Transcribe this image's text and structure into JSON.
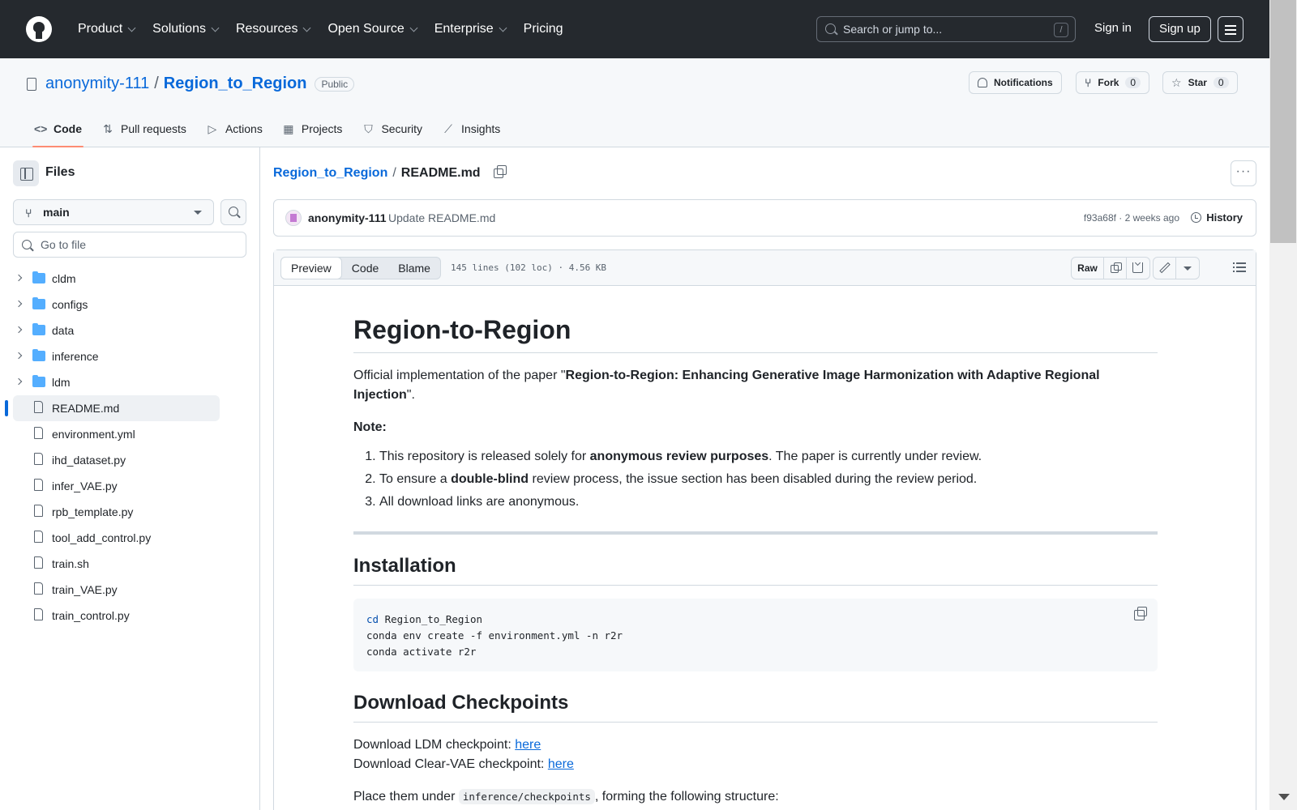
{
  "header": {
    "nav": [
      "Product",
      "Solutions",
      "Resources",
      "Open Source",
      "Enterprise",
      "Pricing"
    ],
    "search_placeholder": "Search or jump to...",
    "search_key": "/",
    "sign_in": "Sign in",
    "sign_up": "Sign up"
  },
  "repo": {
    "owner": "anonymity-111",
    "separator": "/",
    "name": "Region_to_Region",
    "visibility": "Public",
    "notifications_label": "Notifications",
    "fork_label": "Fork",
    "fork_count": "0",
    "star_label": "Star",
    "star_count": "0",
    "tabs": [
      "Code",
      "Pull requests",
      "Actions",
      "Projects",
      "Security",
      "Insights"
    ]
  },
  "sidebar": {
    "title": "Files",
    "branch": "main",
    "goto_placeholder": "Go to file",
    "folders": [
      "cldm",
      "configs",
      "data",
      "inference",
      "ldm"
    ],
    "files": [
      "README.md",
      "environment.yml",
      "ihd_dataset.py",
      "infer_VAE.py",
      "rpb_template.py",
      "tool_add_control.py",
      "train.sh",
      "train_VAE.py",
      "train_control.py"
    ]
  },
  "main": {
    "crumb_repo": "Region_to_Region",
    "crumb_sep": "/",
    "crumb_file": "README.md",
    "kebab": "···",
    "commit": {
      "author": "anonymity-111",
      "message": "Update README.md",
      "hash_time": "f93a68f · 2 weeks ago",
      "history_label": "History"
    },
    "view_tabs": [
      "Preview",
      "Code",
      "Blame"
    ],
    "file_info": "145 lines (102 loc) · 4.56 KB",
    "raw_label": "Raw"
  },
  "readme": {
    "title": "Region-to-Region",
    "intro_prefix": "Official implementation of the paper \"",
    "intro_bold": "Region-to-Region: Enhancing Generative Image Harmonization with Adaptive Regional Injection",
    "intro_suffix": "\".",
    "note_label": "Note:",
    "list": [
      {
        "pre": "This repository is released solely for ",
        "bold": "anonymous review purposes",
        "post": ". The paper is currently under review."
      },
      {
        "pre": "To ensure a ",
        "bold": "double-blind",
        "post": " review process, the issue section has been disabled during the review period."
      },
      {
        "pre": "All download links are anonymous.",
        "bold": "",
        "post": ""
      }
    ],
    "install_heading": "Installation",
    "code_line1_kw": "cd",
    "code_line1_rest": " Region_to_Region",
    "code_line2": "conda env create -f environment.yml -n r2r",
    "code_line3": "conda activate r2r",
    "ckpt_heading": "Download Checkpoints",
    "ldm_prefix": "Download LDM checkpoint: ",
    "ldm_link": "here",
    "vae_prefix": "Download Clear-VAE checkpoint: ",
    "vae_link": "here",
    "place_prefix": "Place them under ",
    "place_code": "inference/checkpoints",
    "place_suffix": ", forming the following structure:"
  },
  "colors": {
    "header_bg": "#25292e",
    "link": "#0969da",
    "folder": "#54aeff",
    "tab_underline": "#fd8c73"
  }
}
